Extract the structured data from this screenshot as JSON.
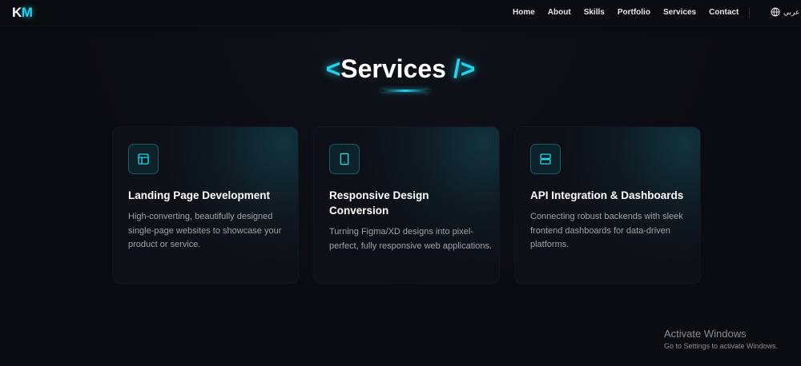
{
  "nav": {
    "logo_k": "K",
    "logo_m": "M",
    "links": [
      "Home",
      "About",
      "Skills",
      "Portfolio",
      "Services",
      "Contact"
    ],
    "lang_label": "عربي",
    "lang_icon": "globe-icon"
  },
  "section": {
    "bracket_open": "<",
    "title": "Services",
    "bracket_close": "/>"
  },
  "cards": [
    {
      "icon": "layout-icon",
      "title": "Landing Page Development",
      "description": "High-converting, beautifully designed single-page websites to showcase your product or service."
    },
    {
      "icon": "tablet-icon",
      "title": "Responsive Design Conversion",
      "description": "Turning Figma/XD designs into pixel-perfect, fully responsive web applications."
    },
    {
      "icon": "server-icon",
      "title": "API Integration & Dashboards",
      "description": "Connecting robust backends with sleek frontend dashboards for data-driven platforms."
    }
  ],
  "watermark": {
    "title": "Activate Windows",
    "subtitle": "Go to Settings to activate Windows."
  },
  "colors": {
    "accent": "#22d3ee",
    "background": "#0b0c11",
    "card": "#0e1017",
    "muted_text": "#9ca3af"
  }
}
